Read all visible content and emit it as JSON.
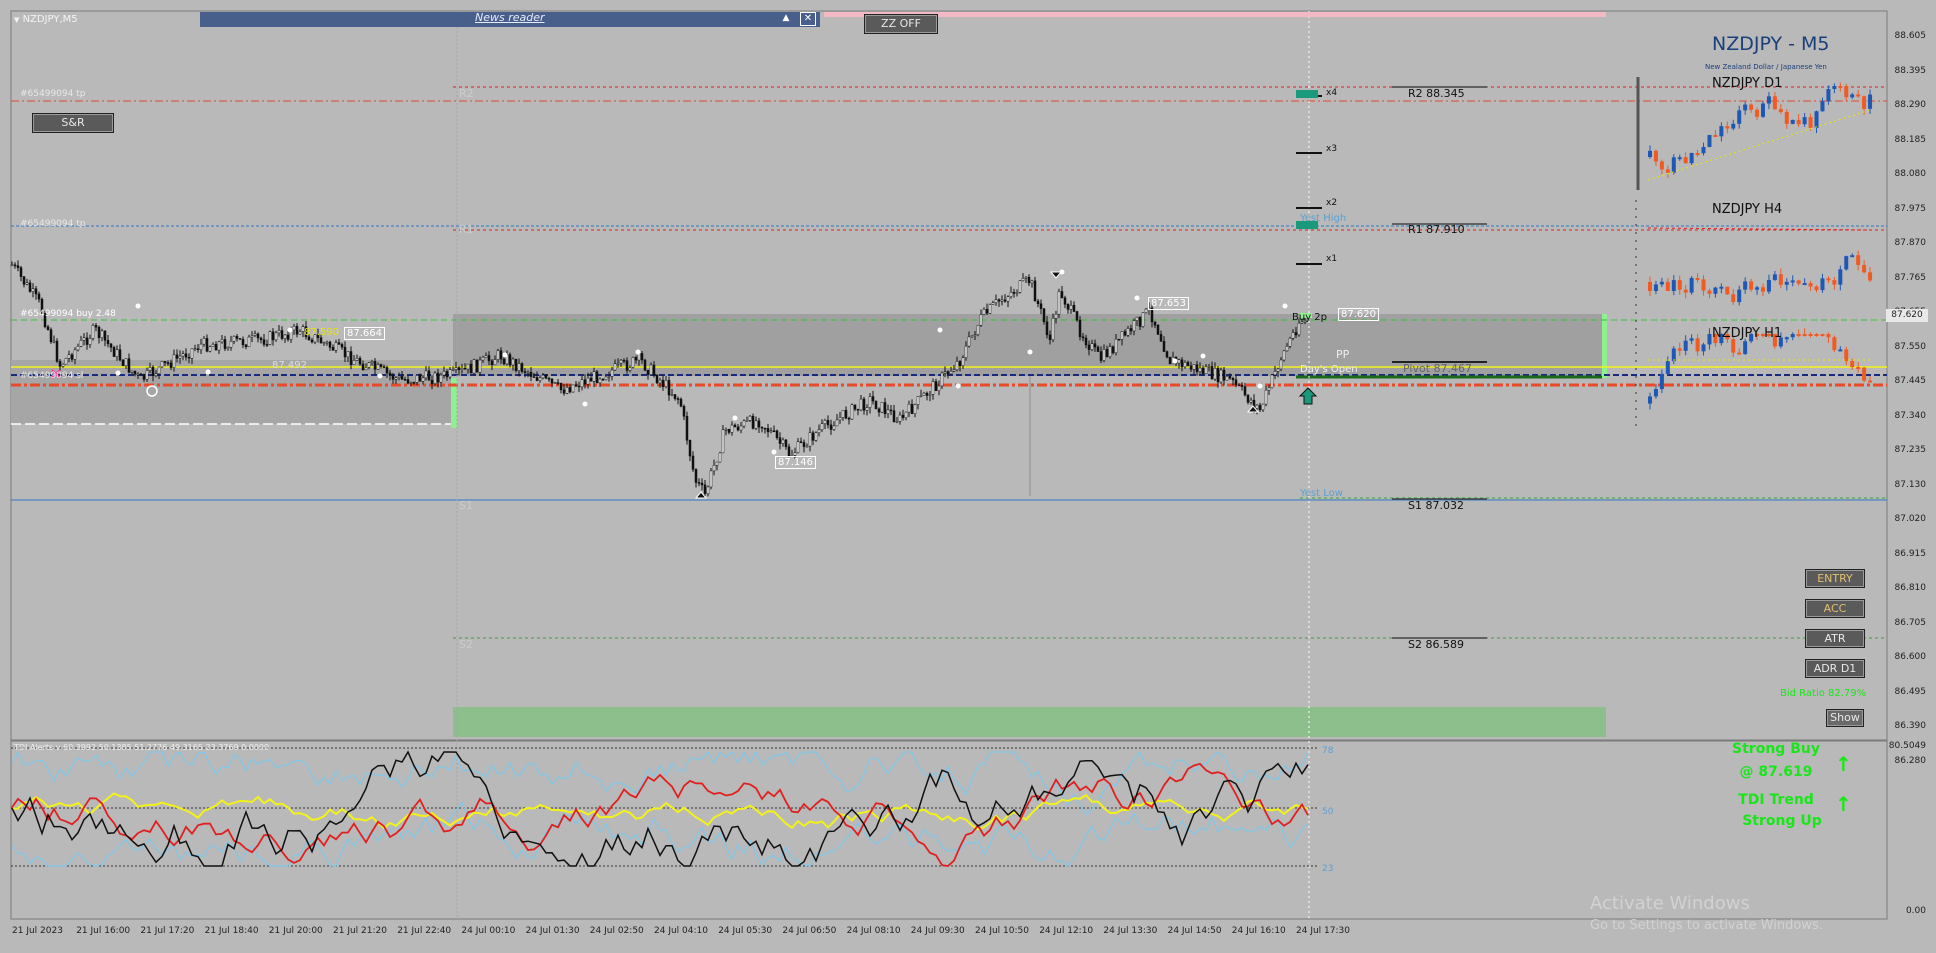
{
  "window": {
    "title": "NZDJPY,M5"
  },
  "news_reader": {
    "label": "News reader",
    "up_icon": "triangle-up",
    "close_icon": "x-box"
  },
  "zz_button": {
    "label": "ZZ OFF"
  },
  "sr_button": {
    "label": "S&R"
  },
  "header": {
    "symbol_title": "NZDJPY - M5",
    "subtitle": "New Zealand Dollar / Japanese Yen"
  },
  "mini_charts": [
    {
      "title": "NZDJPY D1"
    },
    {
      "title": "NZDJPY H4"
    },
    {
      "title": "NZDJPY H1"
    }
  ],
  "order_lines": {
    "tp1": "#65499094 tp",
    "tp2": "#65499094 tp",
    "buy": "#65499094 buy 2.48",
    "sl": "#65499094 sl"
  },
  "pivots": {
    "r2": "R2 88.345",
    "r1": "R1 87.910",
    "pivot": "Pivot 87.467",
    "s1": "S1 87.032",
    "s2": "S2 86.589",
    "r2_short": "R2",
    "r1_short": "R1",
    "s1_short": "S1",
    "s2_short": "S2",
    "pp": "PP",
    "yest_high": "Yest High",
    "yest_low": "Yest Low",
    "day_open": "Day's Open",
    "buy_2p": "Buy 2p"
  },
  "targets": [
    "x4",
    "x3",
    "x2",
    "x1"
  ],
  "price_labels": {
    "high_mark": "87.653",
    "low_mark": "87.146",
    "current_box": "87.620",
    "left_a": "87.664",
    "left_b": "87.492",
    "left_c": "87.590"
  },
  "right_buttons": {
    "entry": "ENTRY",
    "acc": "ACC",
    "atr": "ATR",
    "adr": "ADR D1",
    "bid_ratio": "Bid Ratio 82.79%",
    "show": "Show"
  },
  "price_axis": [
    "88.605",
    "88.395",
    "88.290",
    "88.185",
    "88.080",
    "87.975",
    "87.870",
    "87.765",
    "87.655",
    "87.550",
    "87.445",
    "87.340",
    "87.235",
    "87.130",
    "87.020",
    "86.915",
    "86.810",
    "86.705",
    "86.600",
    "86.495",
    "86.390",
    "86.280"
  ],
  "current_price": "87.620",
  "time_axis": [
    "21 Jul 2023",
    "21 Jul 16:00",
    "21 Jul 17:20",
    "21 Jul 18:40",
    "21 Jul 20:00",
    "21 Jul 21:20",
    "21 Jul 22:40",
    "24 Jul 00:10",
    "24 Jul 01:30",
    "24 Jul 02:50",
    "24 Jul 04:10",
    "24 Jul 05:30",
    "24 Jul 06:50",
    "24 Jul 08:10",
    "24 Jul 09:30",
    "24 Jul 10:50",
    "24 Jul 12:10",
    "24 Jul 13:30",
    "24 Jul 14:50",
    "24 Jul 16:10",
    "24 Jul 17:30"
  ],
  "indicator": {
    "caption": "TDI Alerts v 60.3992 50.1385 51.2776 49.3165 23.3769 0.0000",
    "levels": [
      "78",
      "50",
      "23"
    ],
    "axis_top": "80.5049",
    "axis_bottom": "0.00",
    "strong_buy": "Strong Buy",
    "at_price": "@ 87.619",
    "tdi_trend": "TDI Trend",
    "strong_up": "Strong Up"
  },
  "watermark": {
    "line1": "Activate Windows",
    "line2": "Go to Settings to activate Windows."
  },
  "colors": {
    "bg": "#b9b9b9",
    "bull": "#1f57b5",
    "bear": "#f05a23",
    "signal_green": "#19e619",
    "pivot_red": "#e84a2a",
    "news_bar": "#485f8c",
    "title_blue": "#1a3f7a"
  }
}
